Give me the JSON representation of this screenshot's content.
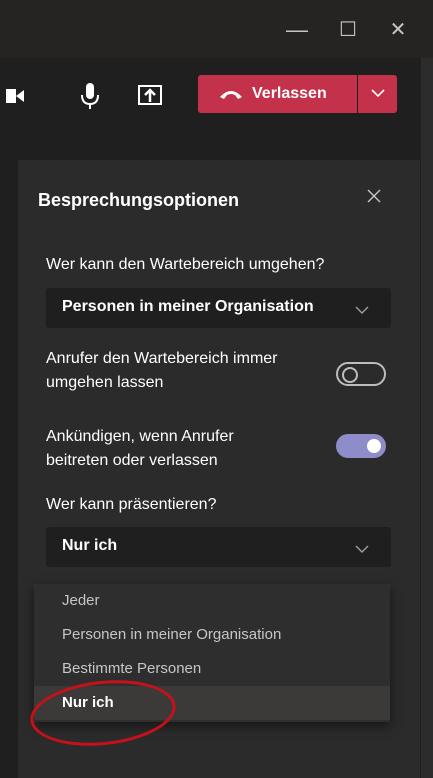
{
  "window": {
    "minimize_glyph": "—",
    "maximize_glyph": "☐",
    "close_glyph": "✕"
  },
  "callbar": {
    "leave_label": "Verlassen",
    "icons": [
      "video-icon",
      "mic-icon",
      "share-screen-icon",
      "phone-hangup-icon",
      "chevron-down-icon"
    ],
    "leave_color": "#c4314b"
  },
  "panel": {
    "title": "Besprechungsoptionen",
    "lobby_question": "Wer kann den Wartebereich umgehen?",
    "lobby_value": "Personen in meiner Organisation",
    "callers_bypass_line1": "Anrufer den Wartebereich immer",
    "callers_bypass_line2": "umgehen lassen",
    "callers_bypass_on": false,
    "announce_line1": "Ankündigen, wenn Anrufer",
    "announce_line2": "beitreten oder verlassen",
    "announce_on": true,
    "presenter_question": "Wer kann präsentieren?",
    "presenter_value": "Nur ich",
    "toggle_color": "#8f8dc9"
  },
  "presenter_options": [
    "Jeder",
    "Personen in meiner Organisation",
    "Bestimmte Personen",
    "Nur ich"
  ],
  "selected_option": "Nur ich",
  "annotation_color": "#c8101a"
}
